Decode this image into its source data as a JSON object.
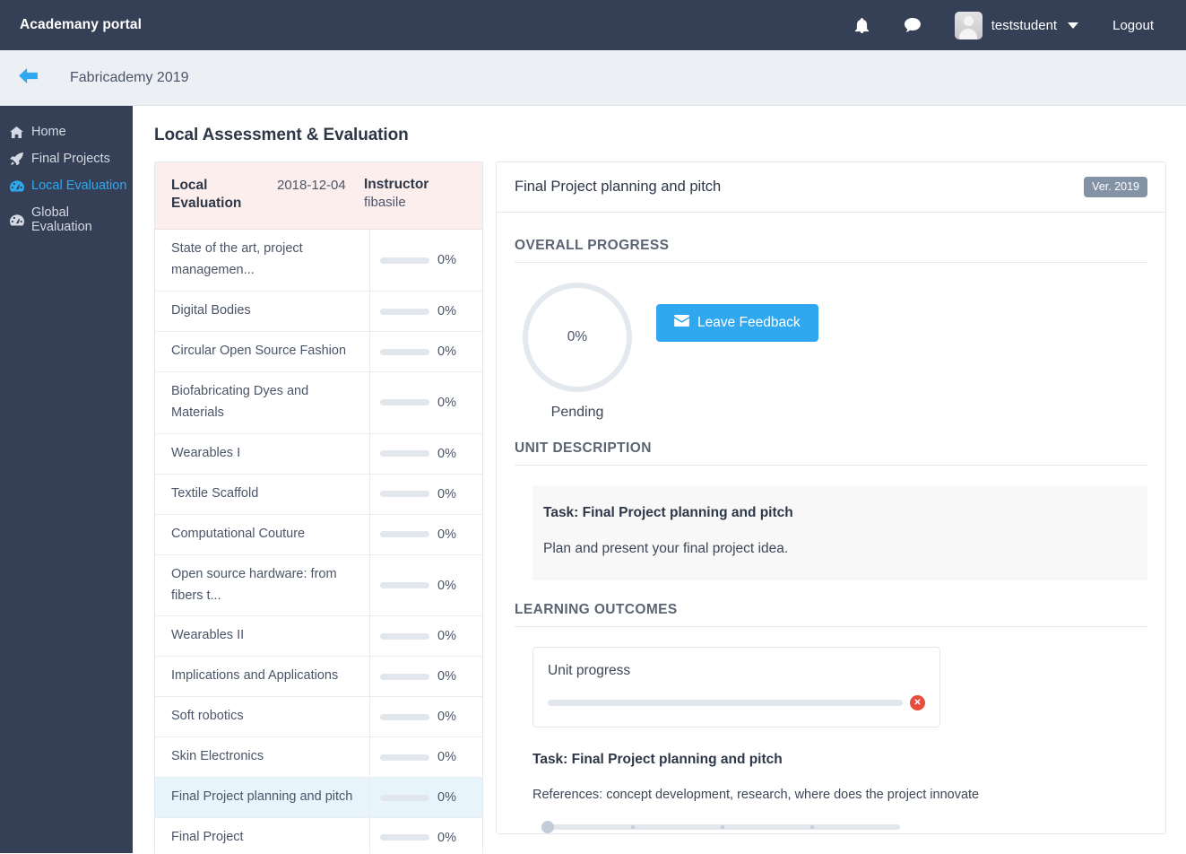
{
  "navbar": {
    "brand": "Academany portal",
    "bell_icon": "bell-icon",
    "message_icon": "comment-icon",
    "user_name": "teststudent",
    "logout_label": "Logout"
  },
  "breadcrumb": {
    "back_icon": "arrow-left-icon",
    "title": "Fabricademy 2019"
  },
  "sidebar": {
    "items": [
      {
        "label": "Home",
        "icon": "home-icon",
        "active": false
      },
      {
        "label": "Final Projects",
        "icon": "rocket-icon",
        "active": false
      },
      {
        "label": "Local Evaluation",
        "icon": "tachometer-icon",
        "active": true
      },
      {
        "label": "Global Evaluation",
        "icon": "tachometer-icon",
        "active": false
      }
    ]
  },
  "main": {
    "page_title": "Local Assessment & Evaluation"
  },
  "eval_table": {
    "header": {
      "title": "Local Evaluation",
      "date": "2018-12-04",
      "instructor_label": "Instructor",
      "instructor_name": "fibasile"
    },
    "rows": [
      {
        "name": "State of the art, project managemen...",
        "percent": "0%",
        "value": 0,
        "selected": false
      },
      {
        "name": "Digital Bodies",
        "percent": "0%",
        "value": 0,
        "selected": false
      },
      {
        "name": "Circular Open Source Fashion",
        "percent": "0%",
        "value": 0,
        "selected": false
      },
      {
        "name": "Biofabricating Dyes and Materials",
        "percent": "0%",
        "value": 0,
        "selected": false
      },
      {
        "name": "Wearables I",
        "percent": "0%",
        "value": 0,
        "selected": false
      },
      {
        "name": "Textile Scaffold",
        "percent": "0%",
        "value": 0,
        "selected": false
      },
      {
        "name": "Computational Couture",
        "percent": "0%",
        "value": 0,
        "selected": false
      },
      {
        "name": "Open source hardware: from fibers t...",
        "percent": "0%",
        "value": 0,
        "selected": false
      },
      {
        "name": "Wearables II",
        "percent": "0%",
        "value": 0,
        "selected": false
      },
      {
        "name": "Implications and Applications",
        "percent": "0%",
        "value": 0,
        "selected": false
      },
      {
        "name": "Soft robotics",
        "percent": "0%",
        "value": 0,
        "selected": false
      },
      {
        "name": "Skin Electronics",
        "percent": "0%",
        "value": 0,
        "selected": false
      },
      {
        "name": "Final Project planning and pitch",
        "percent": "0%",
        "value": 0,
        "selected": true
      },
      {
        "name": "Final Project",
        "percent": "0%",
        "value": 0,
        "selected": false
      }
    ]
  },
  "panel": {
    "title": "Final Project planning and pitch",
    "version_badge": "Ver. 2019",
    "overall_progress": {
      "heading": "OVERALL PROGRESS",
      "ring_value": "0%",
      "status_label": "Pending",
      "feedback_button": "Leave Feedback",
      "feedback_icon": "envelope-icon"
    },
    "unit_description": {
      "heading": "UNIT DESCRIPTION",
      "task_title": "Task: Final Project planning and pitch",
      "body": "Plan and present your final project idea."
    },
    "learning_outcomes": {
      "heading": "LEARNING OUTCOMES",
      "unit_progress_label": "Unit progress",
      "unit_progress_value": 0,
      "reject_icon": "x-circle-icon",
      "task_title": "Task: Final Project planning and pitch",
      "reference_text": "References: concept development, research, where does the project innovate",
      "slider_value": 0,
      "slider_ticks": 3
    }
  },
  "colors": {
    "navbar": "#354056",
    "sidebar": "#354056",
    "accent": "#2fa8ef",
    "table_header_pink": "#fdeeee",
    "selected_row": "#e8f4fc",
    "badge_gray": "#8492a6",
    "danger": "#e74c3c"
  }
}
